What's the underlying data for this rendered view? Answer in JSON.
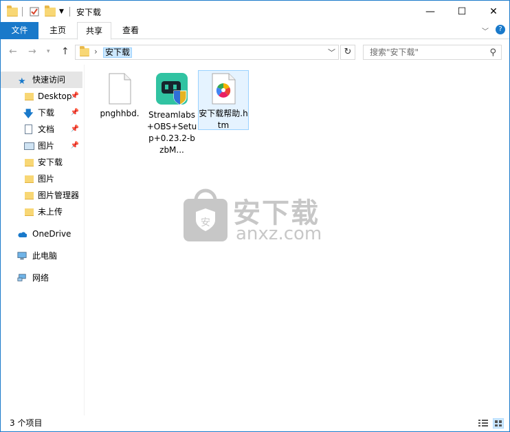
{
  "window": {
    "title": "安下载",
    "controls": {
      "minimize": "—",
      "maximize": "☐",
      "close": "✕"
    }
  },
  "ribbon": {
    "tabs": [
      "文件",
      "主页",
      "共享",
      "查看"
    ],
    "expand_icon": "chevron-down-icon",
    "help_icon": "help-icon"
  },
  "address": {
    "breadcrumb": "安下载",
    "separator": "›",
    "search_placeholder": "搜索\"安下载\""
  },
  "nav": {
    "quick_access": "快速访问",
    "items": [
      {
        "label": "Desktop",
        "pinned": true,
        "icon": "desktop-folder-icon"
      },
      {
        "label": "下载",
        "pinned": true,
        "icon": "download-icon"
      },
      {
        "label": "文档",
        "pinned": true,
        "icon": "documents-icon"
      },
      {
        "label": "图片",
        "pinned": true,
        "icon": "pictures-icon"
      },
      {
        "label": "安下载",
        "pinned": false,
        "icon": "folder-icon"
      },
      {
        "label": "图片",
        "pinned": false,
        "icon": "folder-icon"
      },
      {
        "label": "图片管理器",
        "pinned": false,
        "icon": "folder-icon"
      },
      {
        "label": "未上传",
        "pinned": false,
        "icon": "folder-icon"
      }
    ],
    "onedrive": "OneDrive",
    "this_pc": "此电脑",
    "network": "网络"
  },
  "files": [
    {
      "name": "pnghhbd.",
      "icon": "blank-file-icon"
    },
    {
      "name": "Streamlabs+OBS+Setup+0.23.2-bzbM...",
      "icon": "streamlabs-installer-icon"
    },
    {
      "name": "安下载帮助.htm",
      "icon": "htm-file-icon"
    }
  ],
  "watermark": {
    "text": "安下载",
    "subtext": "anxz.com"
  },
  "status": {
    "count": "3 个项目"
  },
  "colors": {
    "accent": "#1979ca",
    "selection": "#cce8ff",
    "folder": "#f8d775"
  }
}
